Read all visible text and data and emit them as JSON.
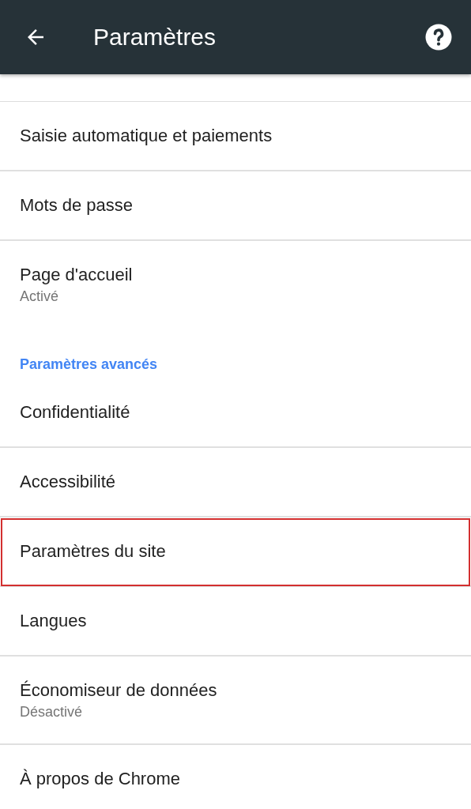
{
  "toolbar": {
    "title": "Paramètres"
  },
  "items": [
    {
      "kind": "item",
      "title": "Saisie automatique et paiements",
      "highlighted": false
    },
    {
      "kind": "item",
      "title": "Mots de passe",
      "highlighted": false
    },
    {
      "kind": "item",
      "title": "Page d'accueil",
      "subtitle": "Activé",
      "highlighted": false
    },
    {
      "kind": "section",
      "title": "Paramètres avancés"
    },
    {
      "kind": "item",
      "title": "Confidentialité",
      "highlighted": false
    },
    {
      "kind": "item",
      "title": "Accessibilité",
      "highlighted": false
    },
    {
      "kind": "item",
      "title": "Paramètres du site",
      "highlighted": true
    },
    {
      "kind": "item",
      "title": "Langues",
      "highlighted": false
    },
    {
      "kind": "item",
      "title": "Économiseur de données",
      "subtitle": "Désactivé",
      "highlighted": false
    },
    {
      "kind": "item",
      "title": "À propos de Chrome",
      "highlighted": false
    }
  ]
}
